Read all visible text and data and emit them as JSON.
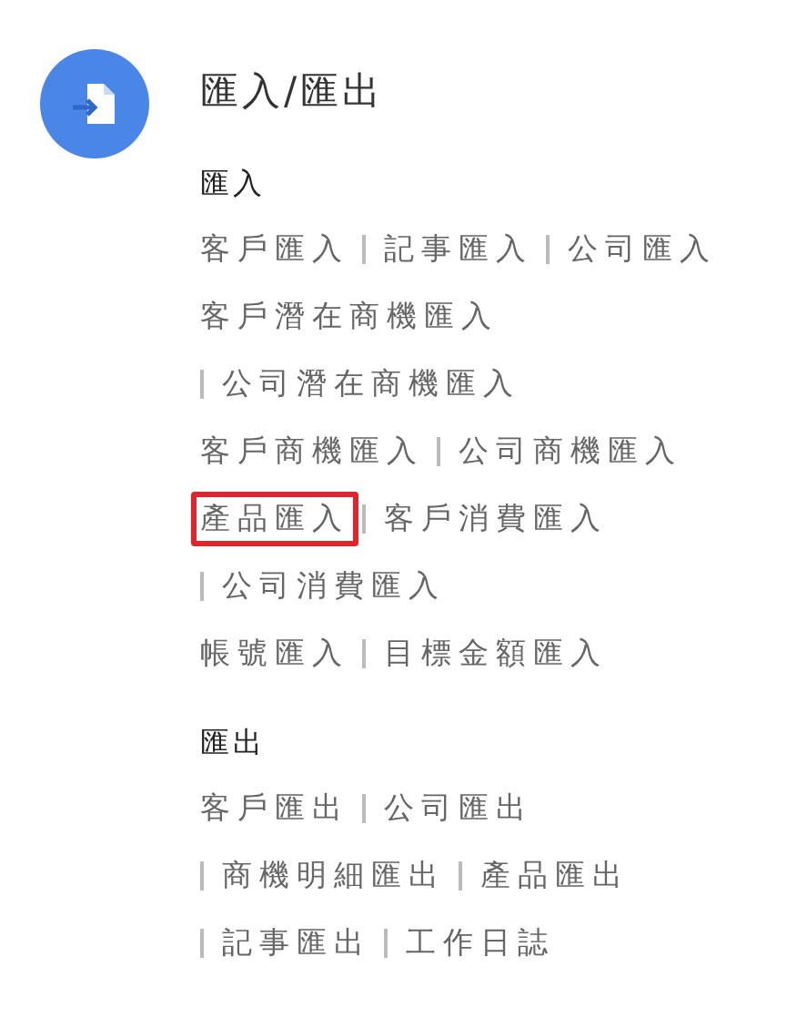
{
  "title": "匯入/匯出",
  "sections": [
    {
      "heading": "匯入",
      "lines": [
        {
          "leading_divider": false,
          "links": [
            {
              "label": "客戶匯入",
              "highlighted": false
            },
            {
              "label": "記事匯入",
              "highlighted": false
            },
            {
              "label": "公司匯入",
              "highlighted": false
            }
          ]
        },
        {
          "leading_divider": false,
          "links": [
            {
              "label": "客戶潛在商機匯入",
              "highlighted": false
            }
          ]
        },
        {
          "leading_divider": true,
          "links": [
            {
              "label": "公司潛在商機匯入",
              "highlighted": false
            }
          ]
        },
        {
          "leading_divider": false,
          "links": [
            {
              "label": "客戶商機匯入",
              "highlighted": false
            },
            {
              "label": "公司商機匯入",
              "highlighted": false
            }
          ]
        },
        {
          "leading_divider": false,
          "links": [
            {
              "label": "產品匯入",
              "highlighted": true
            },
            {
              "label": "客戶消費匯入",
              "highlighted": false
            }
          ]
        },
        {
          "leading_divider": true,
          "links": [
            {
              "label": "公司消費匯入",
              "highlighted": false
            }
          ]
        },
        {
          "leading_divider": false,
          "links": [
            {
              "label": "帳號匯入",
              "highlighted": false
            },
            {
              "label": "目標金額匯入",
              "highlighted": false
            }
          ]
        }
      ]
    },
    {
      "heading": "匯出",
      "lines": [
        {
          "leading_divider": false,
          "links": [
            {
              "label": "客戶匯出",
              "highlighted": false
            },
            {
              "label": "公司匯出",
              "highlighted": false
            }
          ]
        },
        {
          "leading_divider": true,
          "links": [
            {
              "label": "商機明細匯出",
              "highlighted": false
            },
            {
              "label": "產品匯出",
              "highlighted": false
            }
          ]
        },
        {
          "leading_divider": true,
          "links": [
            {
              "label": "記事匯出",
              "highlighted": false
            },
            {
              "label": "工作日誌",
              "highlighted": false
            }
          ]
        }
      ]
    }
  ]
}
